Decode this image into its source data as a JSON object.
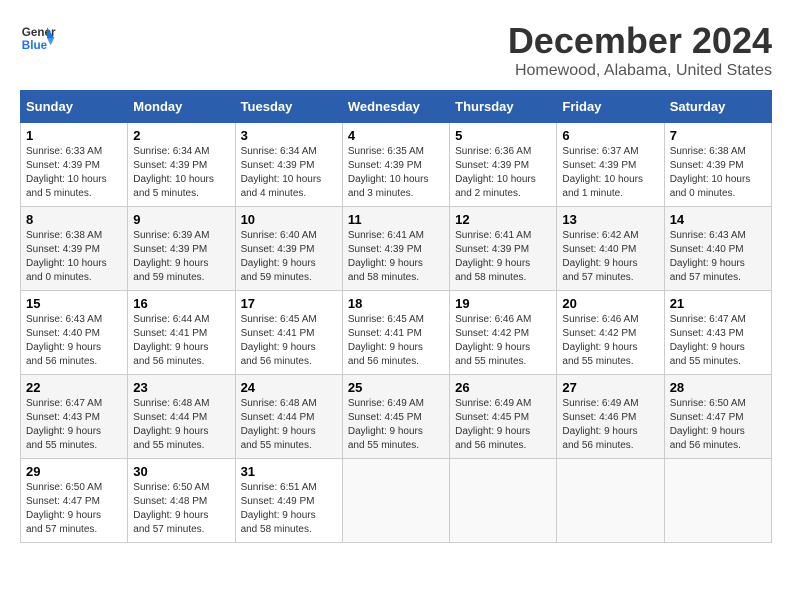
{
  "header": {
    "logo_text_general": "General",
    "logo_text_blue": "Blue",
    "main_title": "December 2024",
    "subtitle": "Homewood, Alabama, United States"
  },
  "calendar": {
    "days_of_week": [
      "Sunday",
      "Monday",
      "Tuesday",
      "Wednesday",
      "Thursday",
      "Friday",
      "Saturday"
    ],
    "weeks": [
      [
        {
          "day": "1",
          "info": "Sunrise: 6:33 AM\nSunset: 4:39 PM\nDaylight: 10 hours\nand 5 minutes."
        },
        {
          "day": "2",
          "info": "Sunrise: 6:34 AM\nSunset: 4:39 PM\nDaylight: 10 hours\nand 5 minutes."
        },
        {
          "day": "3",
          "info": "Sunrise: 6:34 AM\nSunset: 4:39 PM\nDaylight: 10 hours\nand 4 minutes."
        },
        {
          "day": "4",
          "info": "Sunrise: 6:35 AM\nSunset: 4:39 PM\nDaylight: 10 hours\nand 3 minutes."
        },
        {
          "day": "5",
          "info": "Sunrise: 6:36 AM\nSunset: 4:39 PM\nDaylight: 10 hours\nand 2 minutes."
        },
        {
          "day": "6",
          "info": "Sunrise: 6:37 AM\nSunset: 4:39 PM\nDaylight: 10 hours\nand 1 minute."
        },
        {
          "day": "7",
          "info": "Sunrise: 6:38 AM\nSunset: 4:39 PM\nDaylight: 10 hours\nand 0 minutes."
        }
      ],
      [
        {
          "day": "8",
          "info": "Sunrise: 6:38 AM\nSunset: 4:39 PM\nDaylight: 10 hours\nand 0 minutes."
        },
        {
          "day": "9",
          "info": "Sunrise: 6:39 AM\nSunset: 4:39 PM\nDaylight: 9 hours\nand 59 minutes."
        },
        {
          "day": "10",
          "info": "Sunrise: 6:40 AM\nSunset: 4:39 PM\nDaylight: 9 hours\nand 59 minutes."
        },
        {
          "day": "11",
          "info": "Sunrise: 6:41 AM\nSunset: 4:39 PM\nDaylight: 9 hours\nand 58 minutes."
        },
        {
          "day": "12",
          "info": "Sunrise: 6:41 AM\nSunset: 4:39 PM\nDaylight: 9 hours\nand 58 minutes."
        },
        {
          "day": "13",
          "info": "Sunrise: 6:42 AM\nSunset: 4:40 PM\nDaylight: 9 hours\nand 57 minutes."
        },
        {
          "day": "14",
          "info": "Sunrise: 6:43 AM\nSunset: 4:40 PM\nDaylight: 9 hours\nand 57 minutes."
        }
      ],
      [
        {
          "day": "15",
          "info": "Sunrise: 6:43 AM\nSunset: 4:40 PM\nDaylight: 9 hours\nand 56 minutes."
        },
        {
          "day": "16",
          "info": "Sunrise: 6:44 AM\nSunset: 4:41 PM\nDaylight: 9 hours\nand 56 minutes."
        },
        {
          "day": "17",
          "info": "Sunrise: 6:45 AM\nSunset: 4:41 PM\nDaylight: 9 hours\nand 56 minutes."
        },
        {
          "day": "18",
          "info": "Sunrise: 6:45 AM\nSunset: 4:41 PM\nDaylight: 9 hours\nand 56 minutes."
        },
        {
          "day": "19",
          "info": "Sunrise: 6:46 AM\nSunset: 4:42 PM\nDaylight: 9 hours\nand 55 minutes."
        },
        {
          "day": "20",
          "info": "Sunrise: 6:46 AM\nSunset: 4:42 PM\nDaylight: 9 hours\nand 55 minutes."
        },
        {
          "day": "21",
          "info": "Sunrise: 6:47 AM\nSunset: 4:43 PM\nDaylight: 9 hours\nand 55 minutes."
        }
      ],
      [
        {
          "day": "22",
          "info": "Sunrise: 6:47 AM\nSunset: 4:43 PM\nDaylight: 9 hours\nand 55 minutes."
        },
        {
          "day": "23",
          "info": "Sunrise: 6:48 AM\nSunset: 4:44 PM\nDaylight: 9 hours\nand 55 minutes."
        },
        {
          "day": "24",
          "info": "Sunrise: 6:48 AM\nSunset: 4:44 PM\nDaylight: 9 hours\nand 55 minutes."
        },
        {
          "day": "25",
          "info": "Sunrise: 6:49 AM\nSunset: 4:45 PM\nDaylight: 9 hours\nand 55 minutes."
        },
        {
          "day": "26",
          "info": "Sunrise: 6:49 AM\nSunset: 4:45 PM\nDaylight: 9 hours\nand 56 minutes."
        },
        {
          "day": "27",
          "info": "Sunrise: 6:49 AM\nSunset: 4:46 PM\nDaylight: 9 hours\nand 56 minutes."
        },
        {
          "day": "28",
          "info": "Sunrise: 6:50 AM\nSunset: 4:47 PM\nDaylight: 9 hours\nand 56 minutes."
        }
      ],
      [
        {
          "day": "29",
          "info": "Sunrise: 6:50 AM\nSunset: 4:47 PM\nDaylight: 9 hours\nand 57 minutes."
        },
        {
          "day": "30",
          "info": "Sunrise: 6:50 AM\nSunset: 4:48 PM\nDaylight: 9 hours\nand 57 minutes."
        },
        {
          "day": "31",
          "info": "Sunrise: 6:51 AM\nSunset: 4:49 PM\nDaylight: 9 hours\nand 58 minutes."
        },
        {
          "day": "",
          "info": ""
        },
        {
          "day": "",
          "info": ""
        },
        {
          "day": "",
          "info": ""
        },
        {
          "day": "",
          "info": ""
        }
      ]
    ]
  }
}
